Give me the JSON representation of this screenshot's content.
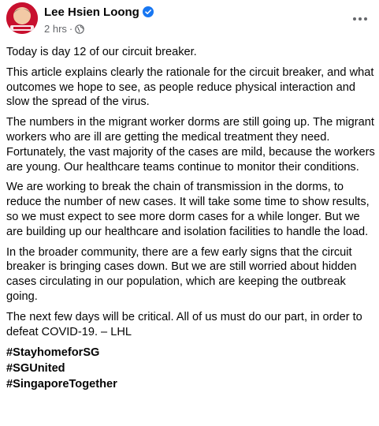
{
  "post": {
    "author": "Lee Hsien Loong",
    "timestamp": "2 hrs",
    "separator": "·",
    "paragraphs": [
      "Today is day 12 of our circuit breaker.",
      "This article explains clearly the rationale for the circuit breaker, and what outcomes we hope to see, as people reduce physical interaction and slow the spread of the virus.",
      "The numbers in the migrant worker dorms are still going up. The migrant workers who are ill are getting the medical treatment they need. Fortunately, the vast majority of the cases are mild, because the workers are young. Our healthcare teams continue to monitor their conditions.",
      "We are working to break the chain of transmission in the dorms, to reduce the number of new cases. It will take some time to show results, so we must expect to see more dorm cases for a while longer. But we are building up our healthcare and isolation facilities to handle the load.",
      "In the broader community, there are a few early signs that the circuit breaker is bringing cases down. But we are still worried about hidden cases circulating in our population, which are keeping the outbreak going.",
      "The next few days will be critical. All of us must do our part, in order to defeat COVID-19. – LHL"
    ],
    "hashtags": [
      "#StayhomeforSG",
      "#SGUnited",
      "#SingaporeTogether"
    ]
  },
  "icons": {
    "verified": "verified-badge-icon",
    "audience": "globe-icon",
    "more": "more-options-icon"
  },
  "colors": {
    "verified_blue": "#1877f2",
    "secondary_text": "#65676b",
    "avatar_red": "#c8102e"
  }
}
